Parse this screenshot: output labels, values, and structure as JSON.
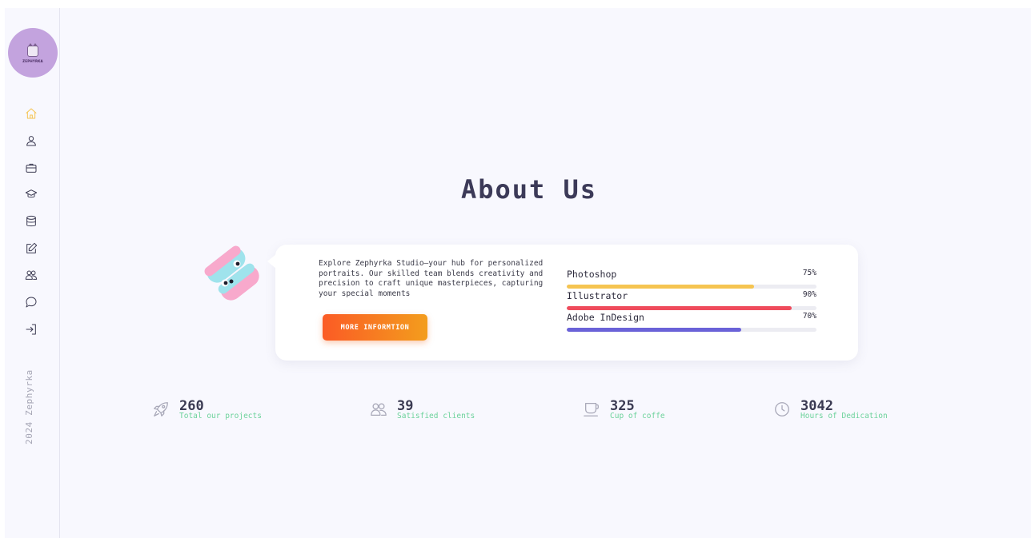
{
  "brand": {
    "logo_text": "ZEPHYRKA",
    "copyright": "2024 Zephyrka"
  },
  "nav": {
    "items": [
      {
        "icon": "home-icon",
        "active": true
      },
      {
        "icon": "user-icon",
        "active": false
      },
      {
        "icon": "briefcase-icon",
        "active": false
      },
      {
        "icon": "graduation-cap-icon",
        "active": false
      },
      {
        "icon": "database-icon",
        "active": false
      },
      {
        "icon": "edit-icon",
        "active": false
      },
      {
        "icon": "users-icon",
        "active": false
      },
      {
        "icon": "chat-icon",
        "active": false
      },
      {
        "icon": "logout-icon",
        "active": false
      }
    ]
  },
  "about": {
    "title": "About Us",
    "description": "Explore Zephyrka Studio—your hub for personalized portraits. Our skilled team blends creativity and precision to craft unique masterpieces, capturing your special moments",
    "cta_label": "MORE INFORMTION",
    "skills": [
      {
        "name": "Photoshop",
        "percent_label": "75%",
        "value": 75,
        "color": "#f5c451"
      },
      {
        "name": "Illustrator",
        "percent_label": "90%",
        "value": 90,
        "color": "#ef4b5c"
      },
      {
        "name": "Adobe InDesign",
        "percent_label": "70%",
        "value": 70,
        "color": "#6a62d8"
      }
    ]
  },
  "stats": [
    {
      "icon": "rocket-icon",
      "number": "260",
      "label": "Total our projects"
    },
    {
      "icon": "users-icon",
      "number": "39",
      "label": "Satisfied clients"
    },
    {
      "icon": "coffee-cup-icon",
      "number": "325",
      "label": "Cup of coffe"
    },
    {
      "icon": "clock-icon",
      "number": "3042",
      "label": "Hours of Dedication"
    }
  ],
  "colors": {
    "accent": "#f5c451",
    "stat_label": "#6cd29b",
    "cta_start": "#fb5b25",
    "cta_end": "#f39d1d",
    "logo_bg": "#c3a3de"
  }
}
